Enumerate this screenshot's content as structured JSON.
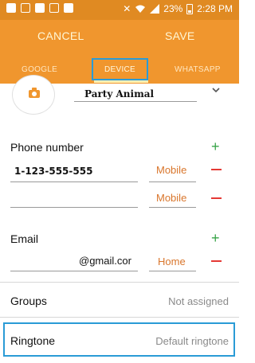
{
  "status_bar": {
    "battery_percent": "23%",
    "time": "2:28 PM",
    "left_icons": [
      "notification-icon",
      "notification-icon",
      "voicemail-icon",
      "notification-icon",
      "briefcase-icon"
    ],
    "right_icons": [
      "mute-icon",
      "wifi-icon",
      "signal-icon",
      "battery-icon"
    ]
  },
  "action_bar": {
    "cancel_label": "CANCEL",
    "save_label": "SAVE"
  },
  "tabs": [
    {
      "label": "GOOGLE",
      "selected": false
    },
    {
      "label": "DEVICE",
      "selected": true
    },
    {
      "label": "WHATSAPP",
      "selected": false
    }
  ],
  "contact": {
    "name": "Party Animal",
    "phone_section_label": "Phone number",
    "phones": [
      {
        "value": "1-123-555-555",
        "type": "Mobile"
      },
      {
        "value": "",
        "type": "Mobile"
      }
    ],
    "email_section_label": "Email",
    "emails": [
      {
        "value": "@gmail.cor",
        "type": "Home"
      }
    ],
    "groups_label": "Groups",
    "groups_value": "Not assigned",
    "ringtone_label": "Ringtone",
    "ringtone_value": "Default ringtone"
  },
  "colors": {
    "action_bar": "#f0962e",
    "status_bar": "#e08a22",
    "highlight_box": "#2a9bd6",
    "add_green": "#3aa54a",
    "remove_red": "#e53935",
    "type_orange": "#d9762c"
  }
}
